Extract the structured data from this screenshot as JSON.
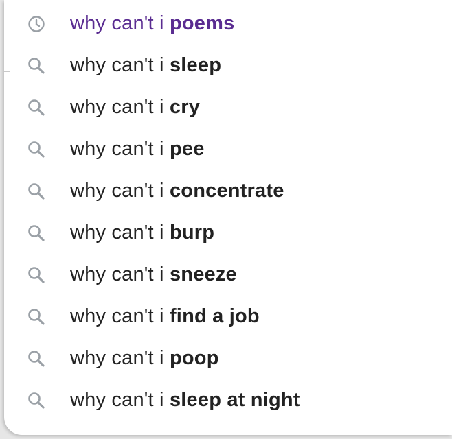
{
  "suggestions": [
    {
      "type": "history",
      "icon": "clock-icon",
      "prefix": "why can't i",
      "completion": "poems"
    },
    {
      "type": "search",
      "icon": "search-icon",
      "prefix": "why can't i",
      "completion": "sleep"
    },
    {
      "type": "search",
      "icon": "search-icon",
      "prefix": "why can't i",
      "completion": "cry"
    },
    {
      "type": "search",
      "icon": "search-icon",
      "prefix": "why can't i",
      "completion": "pee"
    },
    {
      "type": "search",
      "icon": "search-icon",
      "prefix": "why can't i",
      "completion": "concentrate"
    },
    {
      "type": "search",
      "icon": "search-icon",
      "prefix": "why can't i",
      "completion": "burp"
    },
    {
      "type": "search",
      "icon": "search-icon",
      "prefix": "why can't i",
      "completion": "sneeze"
    },
    {
      "type": "search",
      "icon": "search-icon",
      "prefix": "why can't i",
      "completion": "find a job"
    },
    {
      "type": "search",
      "icon": "search-icon",
      "prefix": "why can't i",
      "completion": "poop"
    },
    {
      "type": "search",
      "icon": "search-icon",
      "prefix": "why can't i",
      "completion": "sleep at night"
    }
  ],
  "colors": {
    "history_text": "#5a2c91",
    "text": "#222222",
    "icon": "#9aa0a6"
  }
}
